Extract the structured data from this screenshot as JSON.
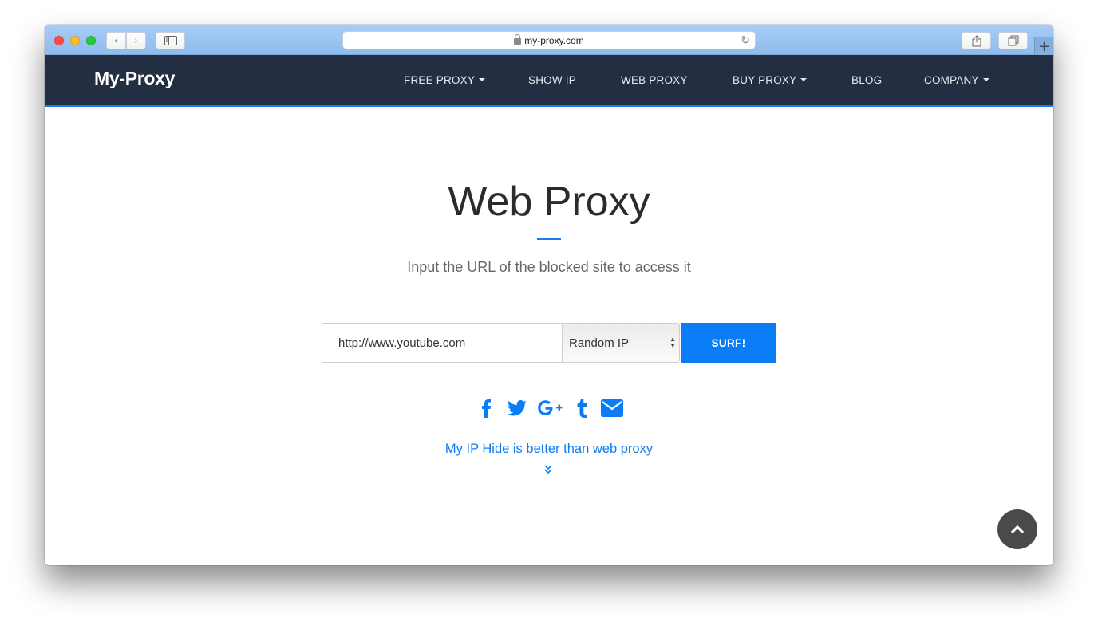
{
  "browser": {
    "address": "my-proxy.com",
    "back_label": "‹",
    "forward_label": "›",
    "reload_glyph": "↻",
    "newtab_glyph": "+"
  },
  "site": {
    "brand": "My-Proxy",
    "nav": [
      {
        "label": "FREE PROXY",
        "dropdown": true
      },
      {
        "label": "SHOW IP",
        "dropdown": false
      },
      {
        "label": "WEB PROXY",
        "dropdown": false
      },
      {
        "label": "BUY PROXY",
        "dropdown": true
      },
      {
        "label": "BLOG",
        "dropdown": false
      },
      {
        "label": "COMPANY",
        "dropdown": true
      }
    ],
    "accent_color": "#0a7cf6",
    "nav_bg_color": "#232e42"
  },
  "hero": {
    "title": "Web Proxy",
    "subtitle": "Input the URL of the blocked site to access it"
  },
  "form": {
    "url_value": "http://www.youtube.com",
    "ip_option": "Random IP",
    "submit_label": "SURF!"
  },
  "social": [
    "facebook-icon",
    "twitter-icon",
    "google-plus-icon",
    "tumblr-icon",
    "email-icon"
  ],
  "more": {
    "link_text": "My IP Hide is better than web proxy"
  }
}
